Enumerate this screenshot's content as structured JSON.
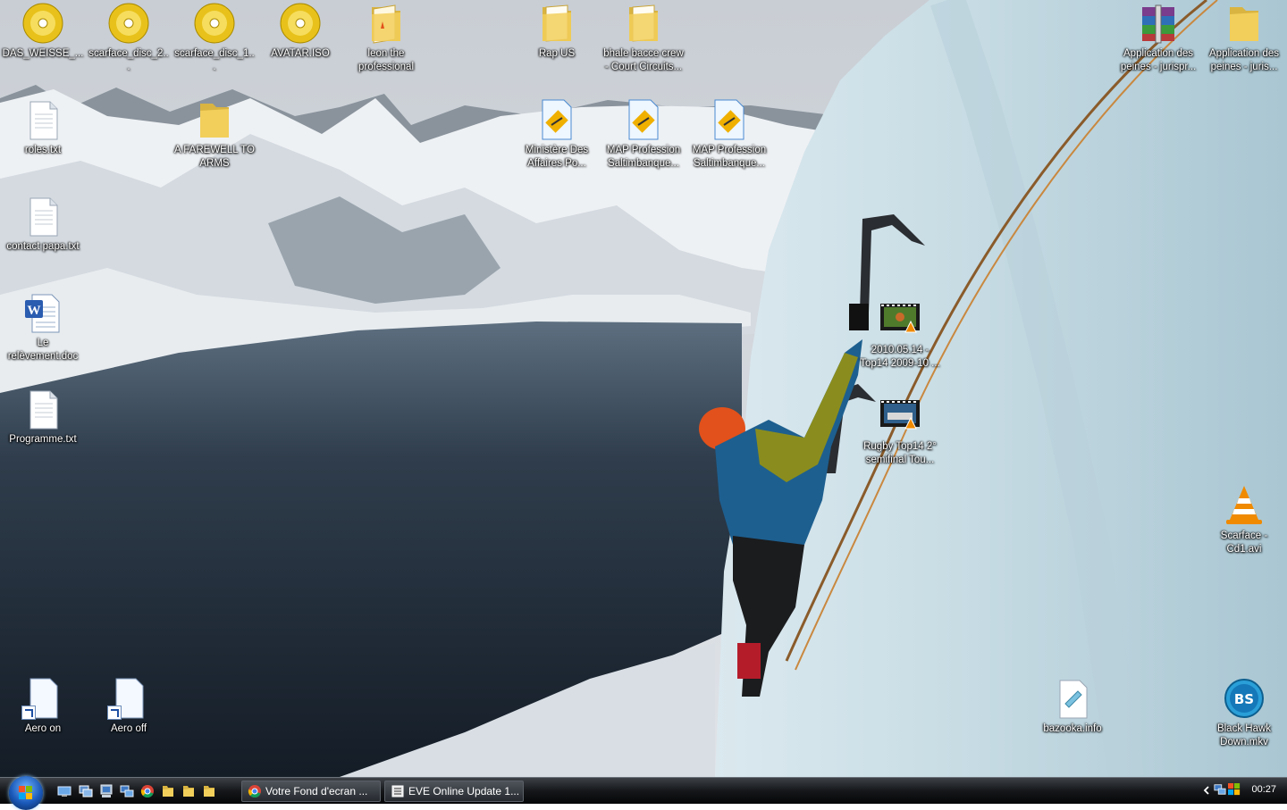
{
  "desktop_icons": [
    {
      "label": "DAS_WEISSE_...",
      "type": "disc"
    },
    {
      "label": "scarface_disc_2...",
      "type": "disc"
    },
    {
      "label": "scarface_disc_1...",
      "type": "disc"
    },
    {
      "label": "AVATAR.ISO",
      "type": "disc"
    },
    {
      "label": "leon the professional",
      "type": "folder"
    },
    {
      "label": "Rap US",
      "type": "folder"
    },
    {
      "label": "bhale bacce crew - Court Circuits...",
      "type": "folder"
    },
    {
      "label": "Application des peines - jurispr...",
      "type": "archive"
    },
    {
      "label": "Application des peines - juris...",
      "type": "folder"
    },
    {
      "label": "roles.txt",
      "type": "text"
    },
    {
      "label": "A FAREWELL TO ARMS",
      "type": "folder"
    },
    {
      "label": "Ministère Des Affaires Po...",
      "type": "map"
    },
    {
      "label": "MAP Profession Saltimbanque...",
      "type": "map"
    },
    {
      "label": "MAP Profession Saltimbanque...",
      "type": "map"
    },
    {
      "label": "contact papa.txt",
      "type": "text"
    },
    {
      "label": "Le relèvement.doc",
      "type": "word"
    },
    {
      "label": "2010.05.14 - Top14 2009-10 ...",
      "type": "video"
    },
    {
      "label": "Programme.txt",
      "type": "text"
    },
    {
      "label": "Rugby Top14 2° semifinal Tou...",
      "type": "video"
    },
    {
      "label": "Scarface - Cd1.avi",
      "type": "vlc"
    },
    {
      "label": "Aero on",
      "type": "shortcut"
    },
    {
      "label": "Aero off",
      "type": "shortcut"
    },
    {
      "label": "bazooka.info",
      "type": "info"
    },
    {
      "label": "Black Hawk Down.mkv",
      "type": "bsplayer"
    }
  ],
  "taskbar": {
    "quick_launch": [
      "show-desktop-icon",
      "switch-windows-icon",
      "computer-icon",
      "network-icon",
      "chrome-icon",
      "folder-icon",
      "folder-icon",
      "folder-icon"
    ],
    "tasks": [
      {
        "label": "Votre Fond d'ecran ...",
        "icon": "chrome-icon"
      },
      {
        "label": "EVE Online Update 1...",
        "icon": "window-icon"
      }
    ],
    "clock": "00:27"
  },
  "colors": {
    "folder": "#f2cf5b",
    "disc": "#e8c21a",
    "taskbar": "#15171a",
    "start_orb": "#1a58b8"
  }
}
